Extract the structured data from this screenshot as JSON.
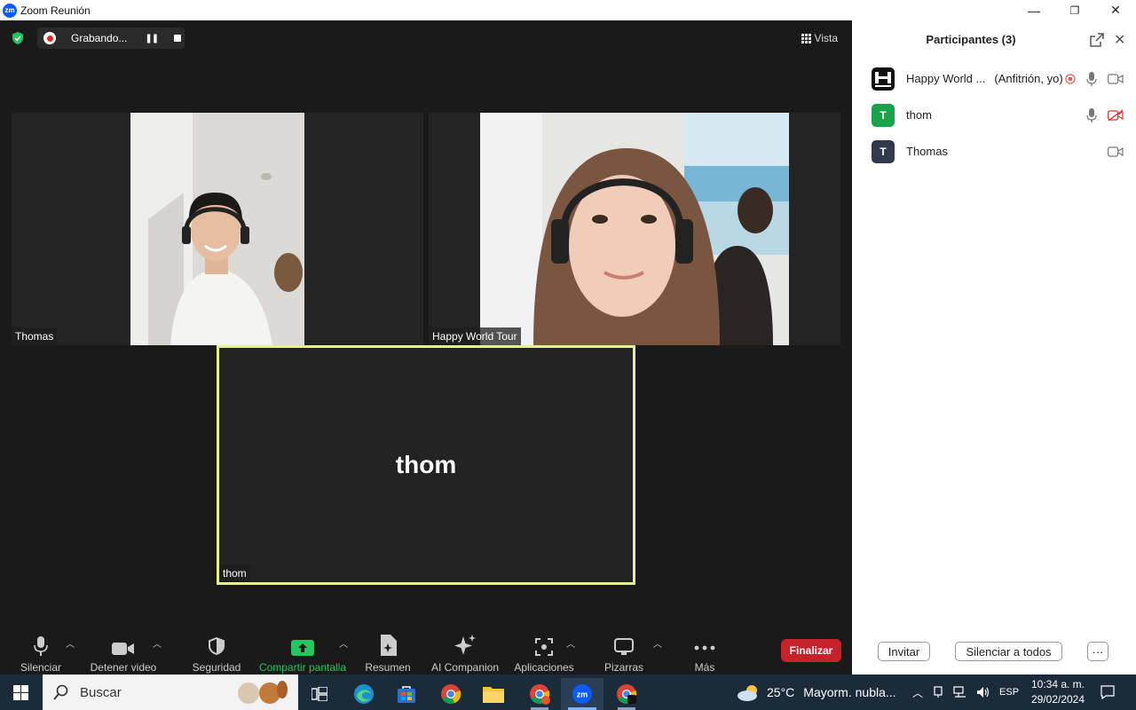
{
  "window": {
    "title": "Zoom Reunión",
    "logo_text": "zm",
    "minimize": "—",
    "maximize": "❐",
    "close": "✕"
  },
  "topbar": {
    "recording_text": "Grabando...",
    "view_label": "Vista"
  },
  "tiles": [
    {
      "name": "Thomas"
    },
    {
      "name": "Happy World Tour"
    },
    {
      "name": "thom",
      "center_text": "thom"
    }
  ],
  "toolbar": {
    "items": [
      {
        "label": "Silenciar",
        "icon": "microphone-icon"
      },
      {
        "label": "Detener video",
        "icon": "video-camera-icon"
      },
      {
        "label": "Seguridad",
        "icon": "shield-icon"
      },
      {
        "label": "Compartir pantalla",
        "icon": "share-screen-icon"
      },
      {
        "label": "Resumen",
        "icon": "summary-icon"
      },
      {
        "label": "AI Companion",
        "icon": "sparkle-icon"
      },
      {
        "label": "Aplicaciones",
        "icon": "apps-icon"
      },
      {
        "label": "Pizarras",
        "icon": "whiteboard-icon"
      },
      {
        "label": "Más",
        "icon": "more-icon"
      }
    ],
    "end_label": "Finalizar",
    "share_color": "#22c55e",
    "end_color": "#c4232b"
  },
  "panel": {
    "title": "Participantes (3)",
    "participants": [
      {
        "name": "Happy World ...",
        "role": "(Anfitrión, yo)",
        "avatar": ""
      },
      {
        "name": "thom",
        "avatar": "T",
        "avatar_color": "#16a34a"
      },
      {
        "name": "Thomas",
        "avatar": "T",
        "avatar_color": "#2f3b4c"
      }
    ],
    "invite_label": "Invitar",
    "mute_all_label": "Silenciar a todos",
    "more_label": "···"
  },
  "taskbar": {
    "search_placeholder": "Buscar",
    "weather_temp": "25°C",
    "weather_text": "Mayorm. nubla...",
    "language": "ESP",
    "time": "10:34 a. m.",
    "date": "29/02/2024"
  }
}
